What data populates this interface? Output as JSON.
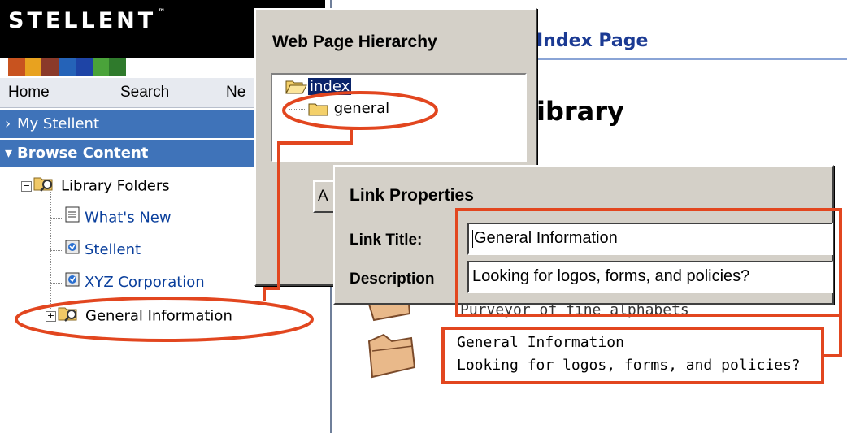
{
  "brand": {
    "name": "STELLENT",
    "tm": "™"
  },
  "brand_stripe_colors": [
    "#c8531f",
    "#e8a21f",
    "#8a3a2a",
    "#2563b8",
    "#1e44a6",
    "#4aa33a",
    "#2f7a2c"
  ],
  "nav": {
    "items": [
      "Home",
      "Search",
      "Ne"
    ]
  },
  "sidebar": {
    "my_stellent": "My Stellent",
    "browse_content": "Browse Content",
    "tree": {
      "root": "Library Folders",
      "items": [
        "What's New",
        "Stellent",
        "XYZ Corporation",
        "General Information"
      ]
    }
  },
  "content": {
    "index_page_title": "Index Page",
    "library_title": "ibrary",
    "partial_line": "Purveyor of fine alphabets",
    "new_link": {
      "title": "General Information",
      "description": "Looking for logos, forms, and policies?"
    }
  },
  "hierarchy_dialog": {
    "title": "Web Page Hierarchy",
    "nodes": [
      "index",
      "general"
    ],
    "button_partial": "A"
  },
  "link_dialog": {
    "title": "Link Properties",
    "link_title_label": "Link Title:",
    "description_label": "Description",
    "link_title_value": "General Information",
    "description_value": "Looking for logos, forms, and policies?",
    "side_partial": "("
  },
  "colors": {
    "accent_blue": "#3f73b9",
    "callout_orange": "#e2461f",
    "link_blue": "#0a3f9c",
    "selection": "#0a246a"
  }
}
